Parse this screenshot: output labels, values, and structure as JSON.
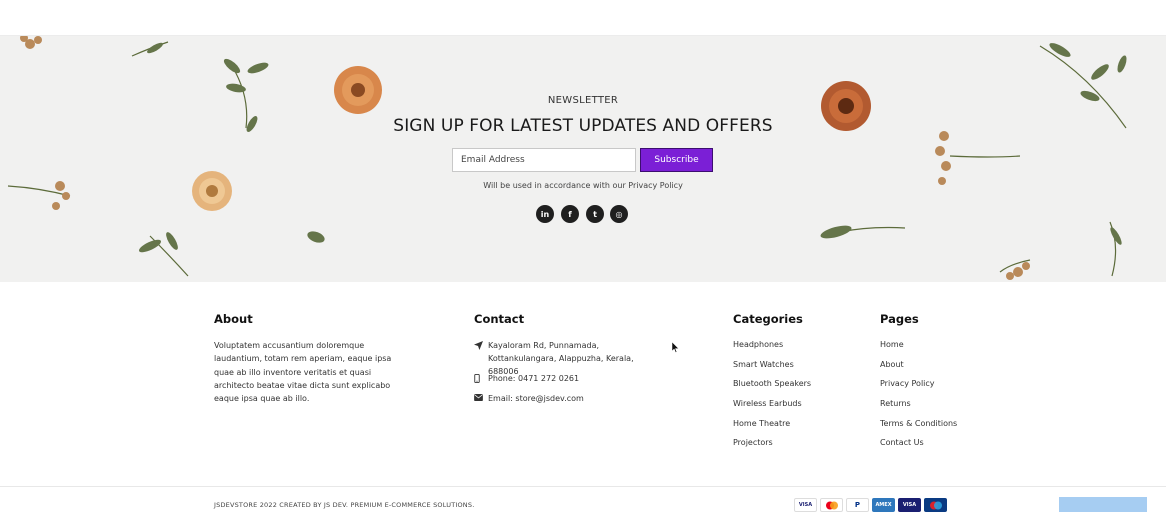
{
  "newsletter": {
    "kicker": "NEWSLETTER",
    "title": "SIGN UP FOR LATEST UPDATES AND OFFERS",
    "email_placeholder": "Email Address",
    "subscribe_label": "Subscribe",
    "note": "Will be used in accordance with our Privacy Policy",
    "socials": [
      {
        "icon": "linkedin-icon",
        "glyph": "in"
      },
      {
        "icon": "facebook-icon",
        "glyph": "f"
      },
      {
        "icon": "twitter-icon",
        "glyph": "t"
      },
      {
        "icon": "instagram-icon",
        "glyph": "◎"
      }
    ]
  },
  "footer": {
    "about": {
      "title": "About",
      "text": "Voluptatem accusantium doloremque laudantium, totam rem aperiam, eaque ipsa quae ab illo inventore veritatis et quasi architecto beatae vitae dicta sunt explicabo eaque ipsa quae ab illo."
    },
    "contact": {
      "title": "Contact",
      "address": "Kayaloram Rd, Punnamada, Kottankulangara, Alappuzha, Kerala, 688006",
      "phone": "Phone: 0471 272 0261",
      "email": "Email: store@jsdev.com"
    },
    "categories": {
      "title": "Categories",
      "items": [
        "Headphones",
        "Smart Watches",
        "Bluetooth Speakers",
        "Wireless Earbuds",
        "Home Theatre",
        "Projectors"
      ]
    },
    "pages": {
      "title": "Pages",
      "items": [
        "Home",
        "About",
        "Privacy Policy",
        "Returns",
        "Terms & Conditions",
        "Contact Us"
      ]
    }
  },
  "bottom": {
    "copyright": "JSDEVSTORE 2022 CREATED BY JS DEV. PREMIUM E-COMMERCE SOLUTIONS.",
    "payment_methods": [
      {
        "name": "visa-icon",
        "label": "VISA",
        "bg": "#ffffff",
        "fg": "#1a1f71"
      },
      {
        "name": "mastercard-icon",
        "label": "",
        "bg": "#ffffff",
        "fg": "#eb001b"
      },
      {
        "name": "paypal-icon",
        "label": "P",
        "bg": "#ffffff",
        "fg": "#003087"
      },
      {
        "name": "amex-icon",
        "label": "AMEX",
        "bg": "#2e77bc",
        "fg": "#ffffff"
      },
      {
        "name": "visa-electron-icon",
        "label": "VISA",
        "bg": "#1a1f71",
        "fg": "#ffffff"
      },
      {
        "name": "maestro-icon",
        "label": "",
        "bg": "#0a3a82",
        "fg": "#ffffff"
      }
    ]
  },
  "colors": {
    "accent": "#7b1fd6",
    "scroll_button": "#a6cdf2"
  }
}
